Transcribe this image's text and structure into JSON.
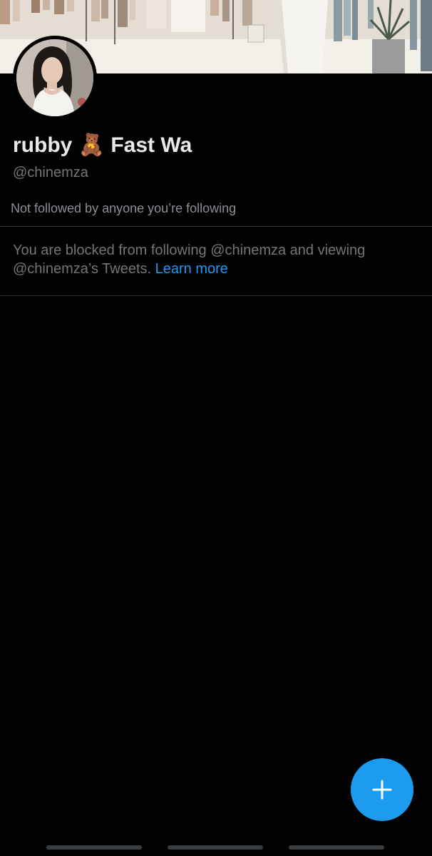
{
  "profile": {
    "display_name": "rubby 🧸 Fast Wa",
    "handle": "@chinemza",
    "followers_note": "Not followed by anyone you’re following",
    "blocked_message": "You are blocked from following @chinemza and viewing @chinemza’s Tweets. ",
    "learn_more_label": "Learn more"
  },
  "fab": {
    "icon": "plus-icon"
  },
  "colors": {
    "background": "#000000",
    "text_primary": "#e7e9ea",
    "text_secondary": "#71767b",
    "accent": "#1d9bf0",
    "divider": "#2f3336"
  }
}
